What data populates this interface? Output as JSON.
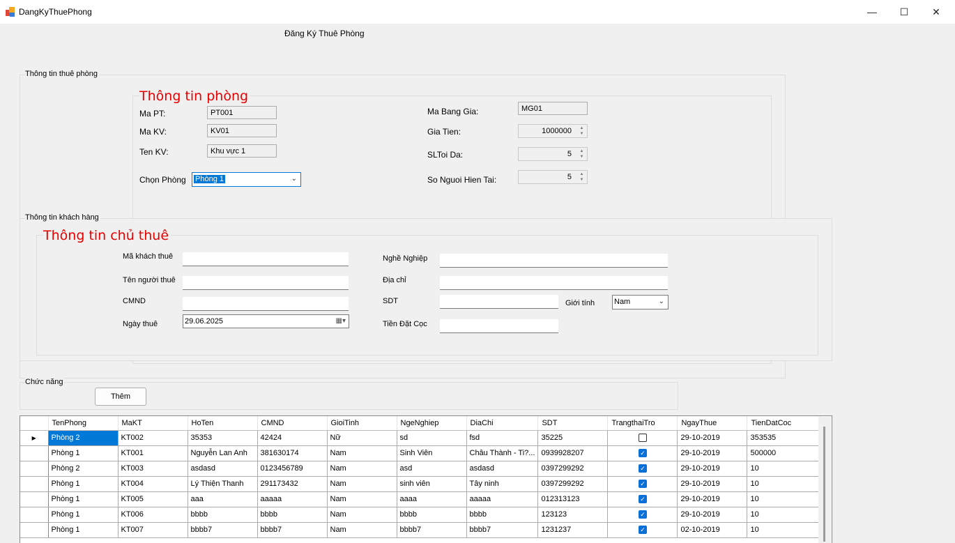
{
  "window": {
    "title": "DangKyThuePhong",
    "minimize_glyph": "—",
    "maximize_glyph": "☐",
    "close_glyph": "✕"
  },
  "form_title": "Đăng Ký Thuê Phòng",
  "room_group": {
    "label": "Thông tin thuê phòng",
    "heading": "Thông tin phòng",
    "ma_pt": {
      "label": "Ma PT:",
      "value": "PT001"
    },
    "ma_kv": {
      "label": "Ma KV:",
      "value": "KV01"
    },
    "ten_kv": {
      "label": "Ten KV:",
      "value": "Khu vực 1"
    },
    "chon_phong": {
      "label": "Chọn Phòng",
      "value": "Phòng 1"
    },
    "ma_bang_gia": {
      "label": "Ma Bang Gia:",
      "value": "MG01"
    },
    "gia_tien": {
      "label": "Gia Tien:",
      "value": "1000000"
    },
    "sl_toi_da": {
      "label": "SLToi Da:",
      "value": "5"
    },
    "so_nguoi": {
      "label": "So Nguoi Hien Tai:",
      "value": "5"
    }
  },
  "customer_group": {
    "label": "Thông tin khách hàng",
    "heading": "Thông tin chủ thuê",
    "ma_khach_thue": {
      "label": "Mã khách thuê",
      "value": ""
    },
    "ten_nguoi_thue": {
      "label": "Tên người thuê",
      "value": ""
    },
    "cmnd": {
      "label": "CMND",
      "value": ""
    },
    "ngay_thue": {
      "label": "Ngày thuê",
      "value": "29.06.2025"
    },
    "nghe_nghiep": {
      "label": "Nghề Nghiệp",
      "value": ""
    },
    "dia_chi": {
      "label": "Địa chỉ",
      "value": ""
    },
    "sdt": {
      "label": "SDT",
      "value": ""
    },
    "gioi_tinh": {
      "label": "Giới tính",
      "value": "Nam"
    },
    "tien_dat_coc": {
      "label": "Tiền Đặt Cọc",
      "value": ""
    }
  },
  "function_group": {
    "label": "Chức năng",
    "add_button": "Thêm"
  },
  "grid": {
    "columns": [
      "TenPhong",
      "MaKT",
      "HoTen",
      "CMND",
      "GioiTinh",
      "NgeNghiep",
      "DiaChi",
      "SDT",
      "TrangthaiTro",
      "NgayThue",
      "TienDatCoc"
    ],
    "rows": [
      {
        "TenPhong": "Phòng 2",
        "MaKT": "KT002",
        "HoTen": "35353",
        "CMND": "42424",
        "GioiTinh": "Nữ",
        "NgeNghiep": "sd",
        "DiaChi": "fsd",
        "SDT": "35225",
        "TrangthaiTro": false,
        "NgayThue": "29-10-2019",
        "TienDatCoc": "353535"
      },
      {
        "TenPhong": "Phòng 1",
        "MaKT": "KT001",
        "HoTen": "Nguyễn Lan Anh",
        "CMND": "381630174",
        "GioiTinh": "Nam",
        "NgeNghiep": "Sinh Viên",
        "DiaChi": "Châu Thành - Ti?...",
        "SDT": "0939928207",
        "TrangthaiTro": true,
        "NgayThue": "29-10-2019",
        "TienDatCoc": "500000"
      },
      {
        "TenPhong": "Phòng 2",
        "MaKT": "KT003",
        "HoTen": "asdasd",
        "CMND": "0123456789",
        "GioiTinh": "Nam",
        "NgeNghiep": "asd",
        "DiaChi": "asdasd",
        "SDT": "0397299292",
        "TrangthaiTro": true,
        "NgayThue": "29-10-2019",
        "TienDatCoc": "10"
      },
      {
        "TenPhong": "Phòng 1",
        "MaKT": "KT004",
        "HoTen": "Lý Thiện Thanh",
        "CMND": "291173432",
        "GioiTinh": "Nam",
        "NgeNghiep": "sinh viên",
        "DiaChi": "Tây ninh",
        "SDT": "0397299292",
        "TrangthaiTro": true,
        "NgayThue": "29-10-2019",
        "TienDatCoc": "10"
      },
      {
        "TenPhong": "Phòng 1",
        "MaKT": "KT005",
        "HoTen": "aaa",
        "CMND": "aaaaa",
        "GioiTinh": "Nam",
        "NgeNghiep": "aaaa",
        "DiaChi": "aaaaa",
        "SDT": "012313123",
        "TrangthaiTro": true,
        "NgayThue": "29-10-2019",
        "TienDatCoc": "10"
      },
      {
        "TenPhong": "Phòng 1",
        "MaKT": "KT006",
        "HoTen": "bbbb",
        "CMND": "bbbb",
        "GioiTinh": "Nam",
        "NgeNghiep": "bbbb",
        "DiaChi": "bbbb",
        "SDT": "123123",
        "TrangthaiTro": true,
        "NgayThue": "29-10-2019",
        "TienDatCoc": "10"
      },
      {
        "TenPhong": "Phòng 1",
        "MaKT": "KT007",
        "HoTen": "bbbb7",
        "CMND": "bbbb7",
        "GioiTinh": "Nam",
        "NgeNghiep": "bbbb7",
        "DiaChi": "bbbb7",
        "SDT": "1231237",
        "TrangthaiTro": true,
        "NgayThue": "02-10-2019",
        "TienDatCoc": "10"
      }
    ]
  },
  "colors": {
    "accent": "#0078d7",
    "heading_red": "#e60000",
    "background": "#f0f0f0"
  }
}
